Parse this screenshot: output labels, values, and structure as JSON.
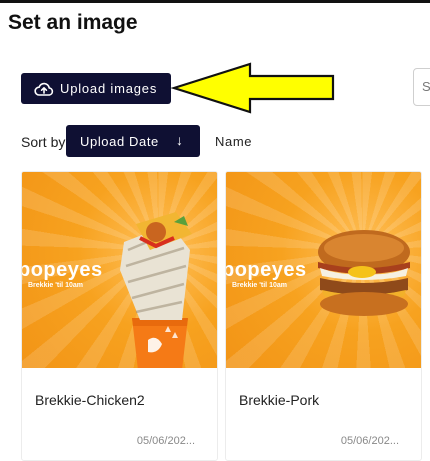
{
  "page": {
    "title": "Set an image"
  },
  "toolbar": {
    "upload_label": "Upload images",
    "search_placeholder": "S"
  },
  "sort": {
    "label": "Sort by",
    "active_label": "Upload Date",
    "direction_icon": "arrow-down-icon",
    "alt_label": "Name"
  },
  "cards": [
    {
      "brand": "popeyes",
      "tagline": "Brekkie 'til 10am",
      "image_subject": "chicken wrap and drink cup",
      "caption": "Brekkie-Chicken2",
      "date": "05/06/202..."
    },
    {
      "brand": "popeyes",
      "tagline": "Brekkie 'til 10am",
      "image_subject": "breakfast burger",
      "caption": "Brekkie-Pork",
      "date": "05/06/202..."
    }
  ],
  "colors": {
    "button_bg": "#0f1033",
    "accent_arrow": "#ffff00",
    "image_bg": "#f7a21f"
  }
}
